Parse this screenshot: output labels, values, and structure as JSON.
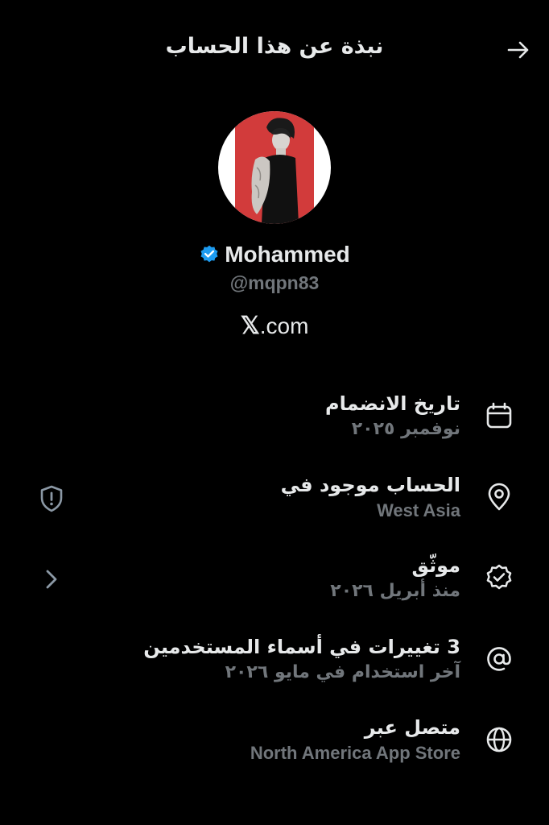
{
  "header": {
    "title": "نبذة عن هذا الحساب",
    "back_icon": "arrow-right-icon"
  },
  "profile": {
    "display_name": "Mohammed",
    "handle": "@mqpn83",
    "verified": true,
    "site_x": "𝕏",
    "site_rest": ".com"
  },
  "rows": [
    {
      "title": "تاريخ الانضمام",
      "subtitle": "نوفمبر ٢٠٢٥",
      "icon": "calendar-icon"
    },
    {
      "title": "الحساب موجود في",
      "subtitle": "West Asia",
      "icon": "location-pin-icon",
      "left_icon": "shield-alert-icon"
    },
    {
      "title": "موثّق",
      "subtitle": "منذ أبريل ٢٠٢٦",
      "icon": "verified-badge-icon",
      "left_icon": "chevron-right-icon"
    },
    {
      "title": "3 تغييرات في أسماء المستخدمين",
      "subtitle": "آخر استخدام في مايو ٢٠٢٦",
      "icon": "at-sign-icon"
    },
    {
      "title": "متصل عبر",
      "subtitle": "North America App Store",
      "icon": "globe-icon"
    }
  ],
  "colors": {
    "background": "#000000",
    "text_primary": "#e7e9ea",
    "text_secondary": "#71767b",
    "verified_blue": "#1d9bf0",
    "avatar_red": "#d23b3b"
  }
}
